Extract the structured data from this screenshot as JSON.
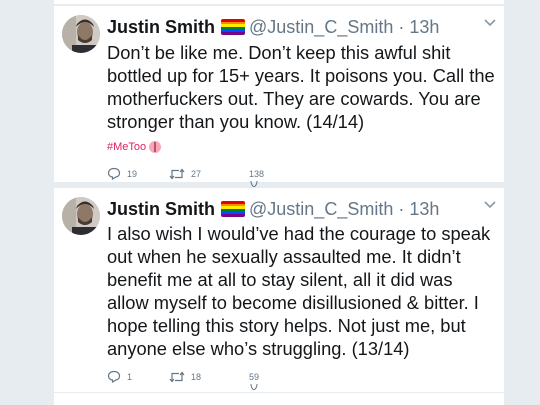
{
  "tweets": [
    {
      "display_name": "Justin Smith",
      "handle": "@Justin_C_Smith",
      "separator": "·",
      "time": "13h",
      "text": "Don’t be like me. Don’t keep this awful shit bottled up for 15+ years. It poisons you. Call the motherfuckers out. They are cowards. You are stronger than you know. (14/14)",
      "hashtag": "#MeToo",
      "reply_count": "19",
      "retweet_count": "27",
      "like_count": "138"
    },
    {
      "display_name": "Justin Smith",
      "handle": "@Justin_C_Smith",
      "separator": "·",
      "time": "13h",
      "text": "I also wish I would’ve had the courage to speak out when he sexually assaulted me. It didn’t benefit me at all to stay silent, all it did was allow myself to become disillusioned & bitter. I hope telling this story helps. Not just me, but anyone else who’s struggling. (13/14)",
      "reply_count": "1",
      "retweet_count": "18",
      "like_count": "59"
    }
  ],
  "colors": {
    "background": "#e6ecf0",
    "card": "#ffffff",
    "text": "#14171a",
    "secondary": "#657786",
    "hashtag": "#e0245e"
  },
  "icons": [
    "reply-icon",
    "retweet-icon",
    "heart-icon",
    "chevron-down-icon",
    "rainbow-flag-icon"
  ]
}
